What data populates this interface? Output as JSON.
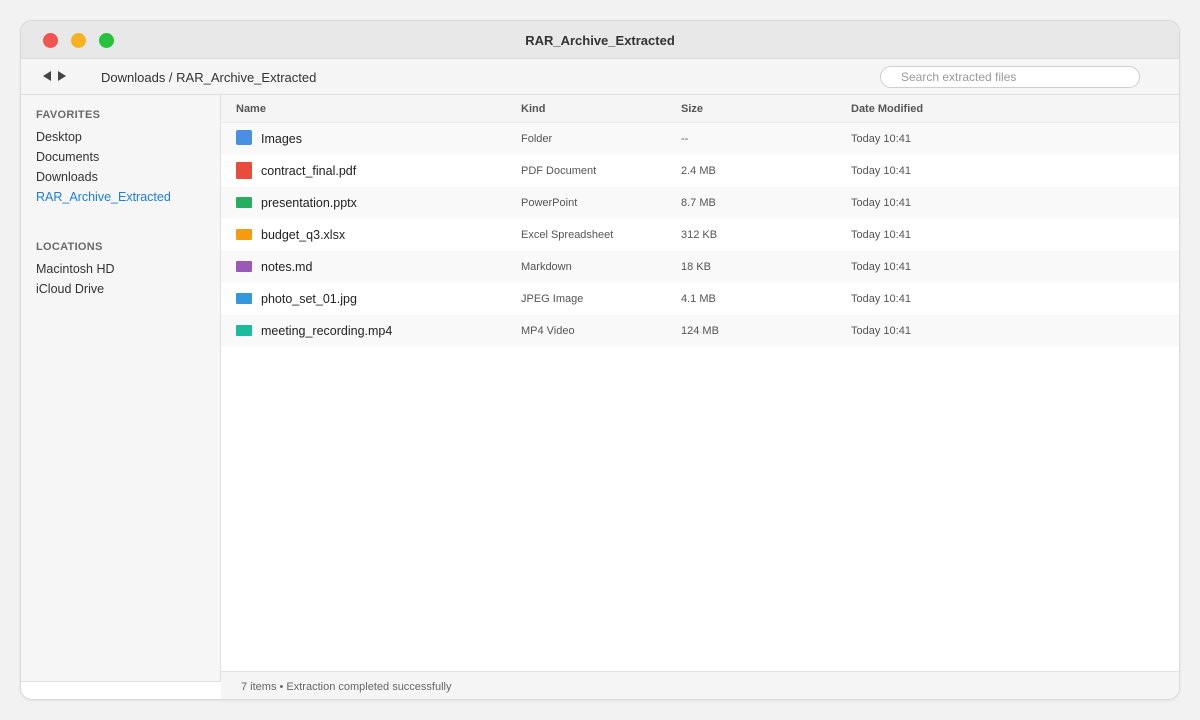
{
  "window": {
    "title": "RAR_Archive_Extracted"
  },
  "toolbar": {
    "breadcrumb": "Downloads / RAR_Archive_Extracted",
    "search_placeholder": "Search extracted files"
  },
  "sidebar": {
    "favorites_label": "FAVORITES",
    "favorites": [
      {
        "label": "Desktop"
      },
      {
        "label": "Documents"
      },
      {
        "label": "Downloads"
      },
      {
        "label": "RAR_Archive_Extracted"
      }
    ],
    "locations_label": "LOCATIONS",
    "locations": [
      {
        "label": "Macintosh HD"
      },
      {
        "label": "iCloud Drive"
      }
    ]
  },
  "table": {
    "columns": {
      "name": "Name",
      "kind": "Kind",
      "size": "Size",
      "date": "Date Modified"
    },
    "rows": [
      {
        "name": "Images",
        "kind": "Folder",
        "size": "--",
        "date": "Today 10:41",
        "icon": "folder-icon",
        "color": "#4a90e2"
      },
      {
        "name": "contract_final.pdf",
        "kind": "PDF Document",
        "size": "2.4 MB",
        "date": "Today 10:41",
        "icon": "pdf-file-icon",
        "color": "#e74c3c"
      },
      {
        "name": "presentation.pptx",
        "kind": "PowerPoint",
        "size": "8.7 MB",
        "date": "Today 10:41",
        "icon": "powerpoint-file-icon",
        "color": "#27ae60"
      },
      {
        "name": "budget_q3.xlsx",
        "kind": "Excel Spreadsheet",
        "size": "312 KB",
        "date": "Today 10:41",
        "icon": "spreadsheet-file-icon",
        "color": "#f39c12"
      },
      {
        "name": "notes.md",
        "kind": "Markdown",
        "size": "18 KB",
        "date": "Today 10:41",
        "icon": "markdown-file-icon",
        "color": "#9b59b6"
      },
      {
        "name": "photo_set_01.jpg",
        "kind": "JPEG Image",
        "size": "4.1 MB",
        "date": "Today 10:41",
        "icon": "image-file-icon",
        "color": "#3498db"
      },
      {
        "name": "meeting_recording.mp4",
        "kind": "MP4 Video",
        "size": "124 MB",
        "date": "Today 10:41",
        "icon": "video-file-icon",
        "color": "#1abc9c"
      }
    ]
  },
  "status": {
    "text": "7 items • Extraction completed successfully"
  },
  "colors": {
    "close": "#f0554f",
    "minimize": "#f5b324",
    "maximize": "#27c13d",
    "accent": "#1a7ee6"
  }
}
